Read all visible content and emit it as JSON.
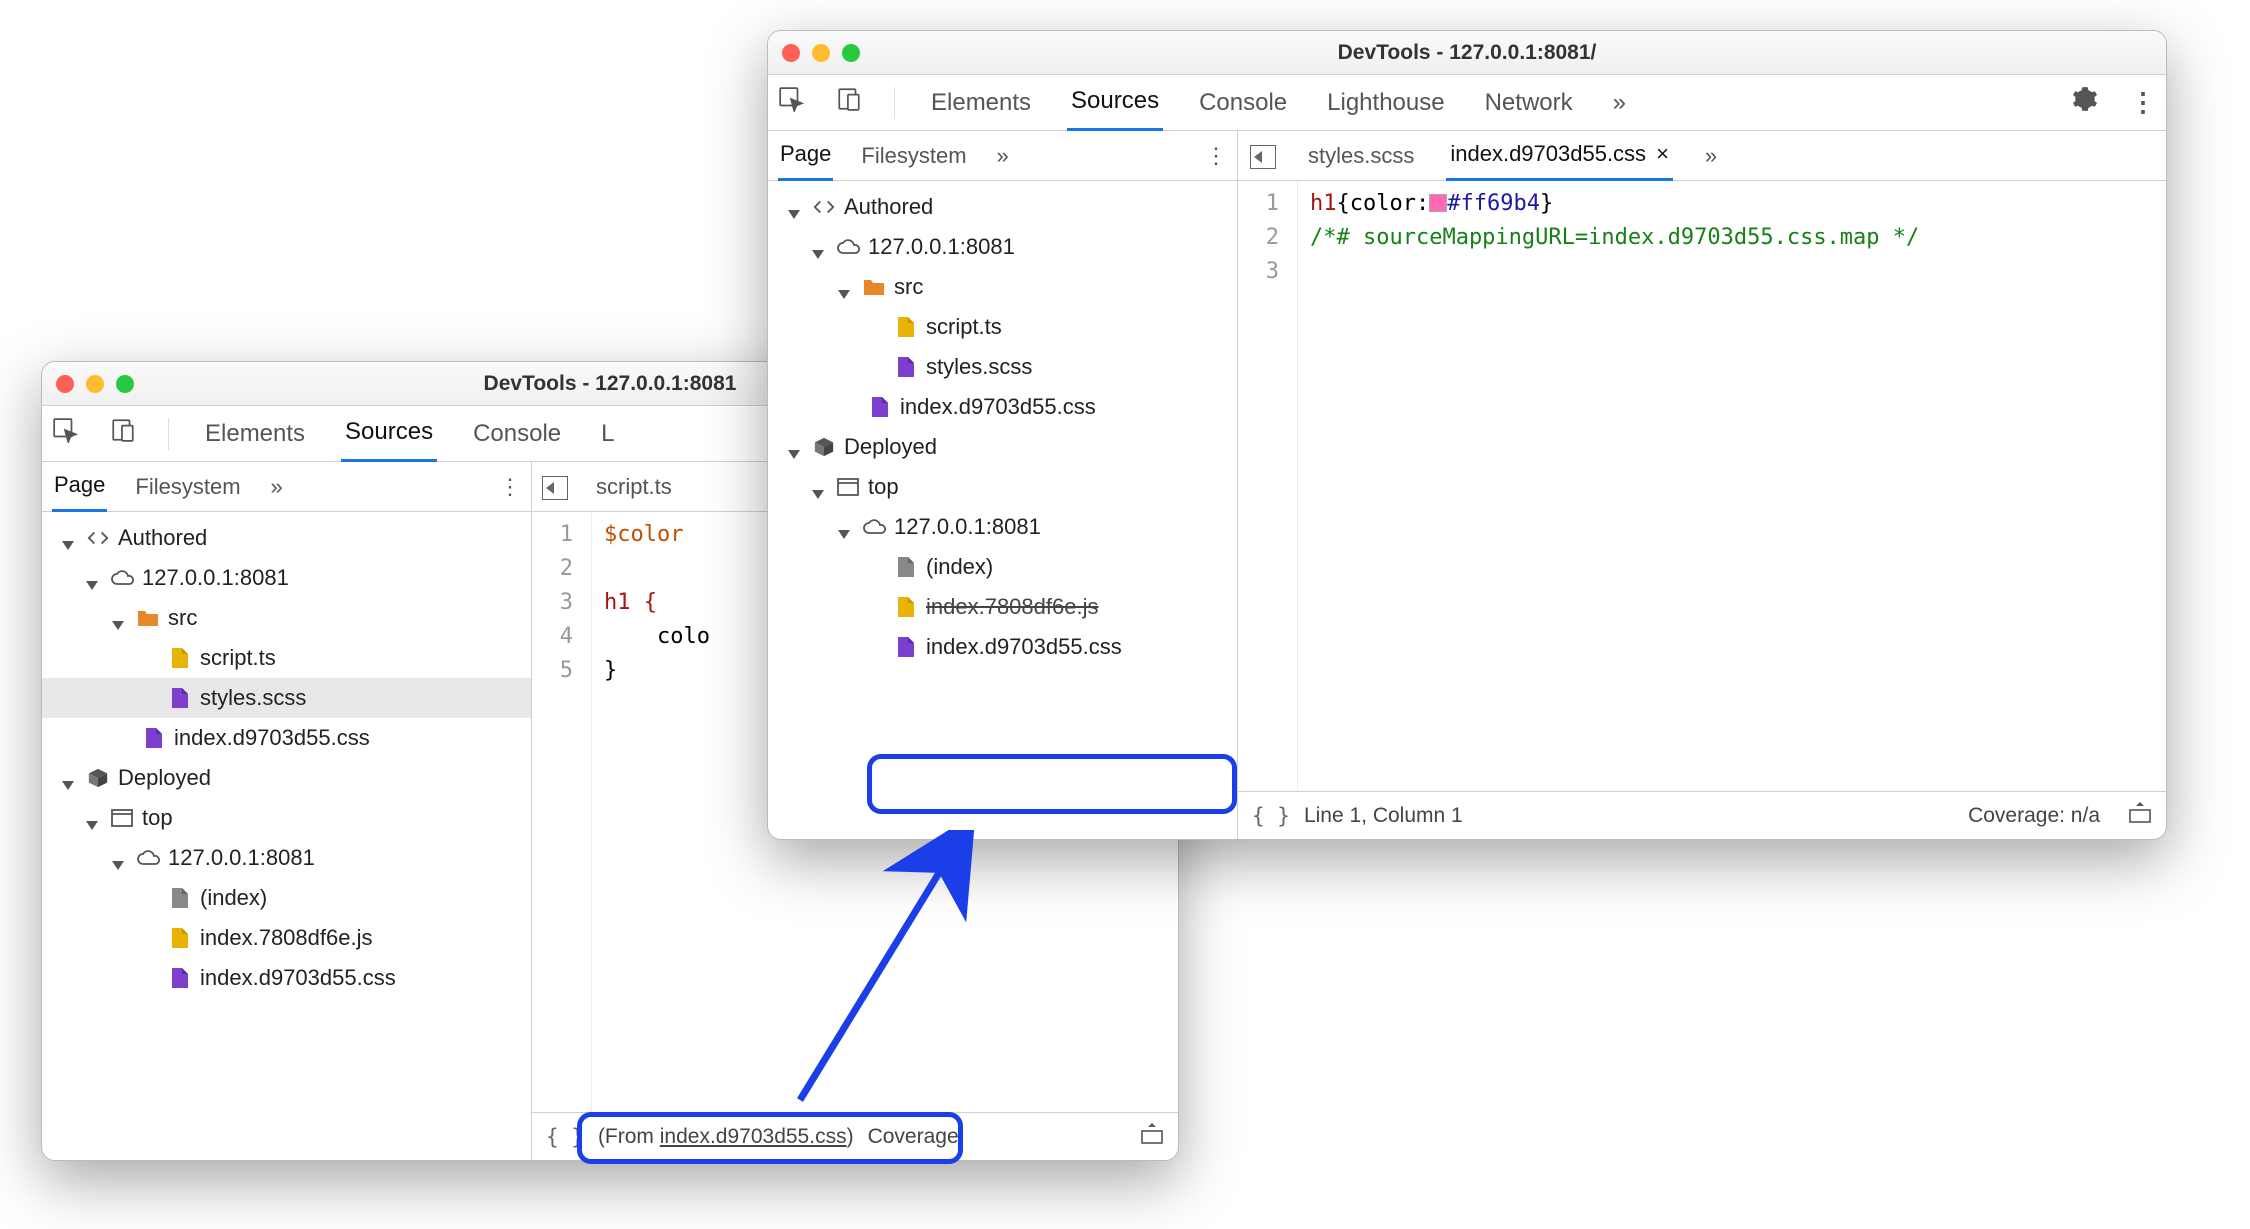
{
  "win1": {
    "title": "DevTools - 127.0.0.1:8081",
    "toolbar": {
      "elements": "Elements",
      "sources": "Sources",
      "console": "Console",
      "more_letter": "L"
    },
    "sidebar": {
      "page": "Page",
      "filesystem": "Filesystem",
      "more": "»"
    },
    "tree": {
      "authored": "Authored",
      "host": "127.0.0.1:8081",
      "src": "src",
      "script": "script.ts",
      "styles": "styles.scss",
      "css": "index.d9703d55.css",
      "deployed": "Deployed",
      "top": "top",
      "host2": "127.0.0.1:8081",
      "index": "(index)",
      "js": "index.7808df6e.js",
      "css2": "index.d9703d55.css"
    },
    "tabstrip": {
      "file": "script.ts"
    },
    "editor": {
      "l1": "$color",
      "l3a": "h1 {",
      "l4": "    colo",
      "l5": "}"
    },
    "status": {
      "from": "(From ",
      "file": "index.d9703d55.css",
      "close": ")",
      "coverage": "Coverage:"
    }
  },
  "win2": {
    "title": "DevTools - 127.0.0.1:8081/",
    "toolbar": {
      "elements": "Elements",
      "sources": "Sources",
      "console": "Console",
      "lighthouse": "Lighthouse",
      "network": "Network",
      "more": "»"
    },
    "sidebar": {
      "page": "Page",
      "filesystem": "Filesystem",
      "more": "»"
    },
    "tree": {
      "authored": "Authored",
      "host": "127.0.0.1:8081",
      "src": "src",
      "script": "script.ts",
      "styles": "styles.scss",
      "css": "index.d9703d55.css",
      "deployed": "Deployed",
      "top": "top",
      "host2": "127.0.0.1:8081",
      "index": "(index)",
      "jscut": "index.7808df6e.js",
      "css2": "index.d9703d55.css"
    },
    "tabstrip": {
      "styles": "styles.scss",
      "css": "index.d9703d55.css",
      "more": "»"
    },
    "editor": {
      "sel": "h1",
      "open": "{",
      "prop": "color",
      "colon": ":",
      "hex": "#ff69b4",
      "close": "}",
      "comment": "/*# sourceMappingURL=index.d9703d55.css.map */"
    },
    "status": {
      "line": "Line 1, Column 1",
      "coverage": "Coverage: n/a"
    }
  }
}
